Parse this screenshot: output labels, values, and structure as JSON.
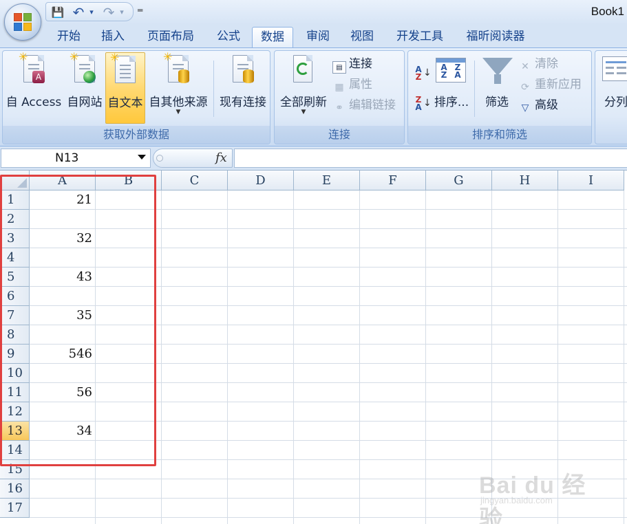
{
  "window": {
    "doc_title": "Book1"
  },
  "quick_access": {
    "save": "💾",
    "undo": "↶",
    "redo": "↷",
    "more": "▾"
  },
  "tabs": [
    {
      "label": "开始"
    },
    {
      "label": "插入"
    },
    {
      "label": "页面布局"
    },
    {
      "label": "公式"
    },
    {
      "label": "数据",
      "active": true
    },
    {
      "label": "审阅"
    },
    {
      "label": "视图"
    },
    {
      "label": "开发工具"
    },
    {
      "label": "福昕阅读器"
    }
  ],
  "ribbon": {
    "get_external": {
      "label": "获取外部数据",
      "from_access": "自 Access",
      "from_web": "自网站",
      "from_text": "自文本",
      "from_other": "自其他来源",
      "existing": "现有连接"
    },
    "connections": {
      "label": "连接",
      "refresh_all": "全部刷新",
      "connections": "连接",
      "properties": "属性",
      "edit_links": "编辑链接"
    },
    "sort_filter": {
      "label": "排序和筛选",
      "sort": "排序...",
      "filter": "筛选",
      "clear": "清除",
      "reapply": "重新应用",
      "advanced": "高级"
    },
    "data_tools": {
      "text_to_columns": "分列"
    }
  },
  "formula_bar": {
    "name_box": "N13",
    "fx": "fx",
    "formula": ""
  },
  "sheet": {
    "columns": [
      "A",
      "B",
      "C",
      "D",
      "E",
      "F",
      "G",
      "H",
      "I"
    ],
    "rows": [
      "1",
      "2",
      "3",
      "4",
      "5",
      "6",
      "7",
      "8",
      "9",
      "10",
      "11",
      "12",
      "13",
      "14",
      "15",
      "16",
      "17"
    ],
    "active_row": "13",
    "column_a_values": [
      "21",
      "",
      "32",
      "",
      "43",
      "",
      "35",
      "",
      "546",
      "",
      "56",
      "",
      "34",
      "",
      "",
      "",
      ""
    ]
  },
  "colors": {
    "highlight_box": "#e0403f",
    "active_row_header": "#f7c75b",
    "ribbon_selected": "#ffd973"
  },
  "watermark": {
    "brand": "Bai du 经验",
    "url": "jingyan.baidu.com"
  }
}
